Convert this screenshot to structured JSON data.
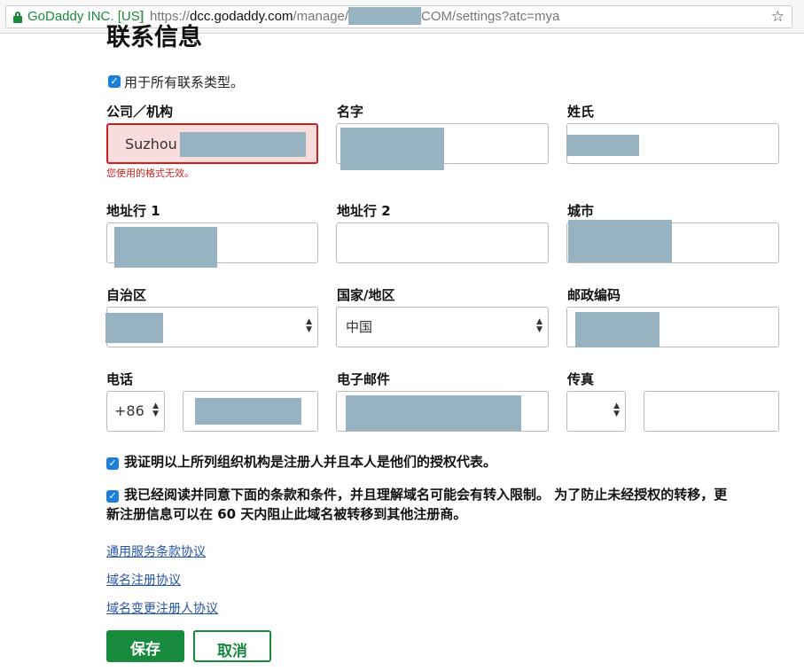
{
  "browser": {
    "site_identity": "GoDaddy INC. [US]",
    "url_prefix": "https://",
    "url_host": "dcc.godaddy.com",
    "url_path_start": "/manage/",
    "url_path_end": "COM/settings?atc=mya"
  },
  "page": {
    "title": "联系信息",
    "apply_all_label": "用于所有联系类型。"
  },
  "fields": {
    "company": {
      "label": "公司／机构",
      "value": "Suzhou",
      "error": "您使用的格式无效。"
    },
    "first_name": {
      "label": "名字"
    },
    "last_name": {
      "label": "姓氏"
    },
    "address1": {
      "label": "地址行 1"
    },
    "address2": {
      "label": "地址行 2"
    },
    "city": {
      "label": "城市"
    },
    "state": {
      "label": "自治区"
    },
    "country": {
      "label": "国家/地区",
      "value": "中国"
    },
    "postal": {
      "label": "邮政编码"
    },
    "phone": {
      "label": "电话",
      "country_code": "+86"
    },
    "email": {
      "label": "电子邮件"
    },
    "fax": {
      "label": "传真"
    }
  },
  "confirmations": {
    "authorized": "我证明以上所列组织机构是注册人并且本人是他们的授权代表。",
    "terms_line1": "我已经阅读并同意下面的条款和条件，并且理解域名可能会有转入限制。 为了防止未经授权的转移，更",
    "terms_line2": "新注册信息可以在 60 天内阻止此域名被转移到其他注册商。"
  },
  "links": {
    "general_terms": "通用服务条款协议",
    "domain_registration": "域名注册协议",
    "registrant_change": "域名变更注册人协议"
  },
  "buttons": {
    "save": "保存",
    "cancel": "取消"
  },
  "colors": {
    "accent_green": "#188a3d",
    "error_red": "#cf1f1f",
    "link_blue": "#2654a5",
    "checkbox_blue": "#1e7fd6",
    "redaction": "#97b3c2"
  },
  "icons": {
    "lock": "lock-icon",
    "star": "bookmark-star-icon",
    "checkbox": "checkbox-checked-icon",
    "select": "select-arrows-icon"
  }
}
